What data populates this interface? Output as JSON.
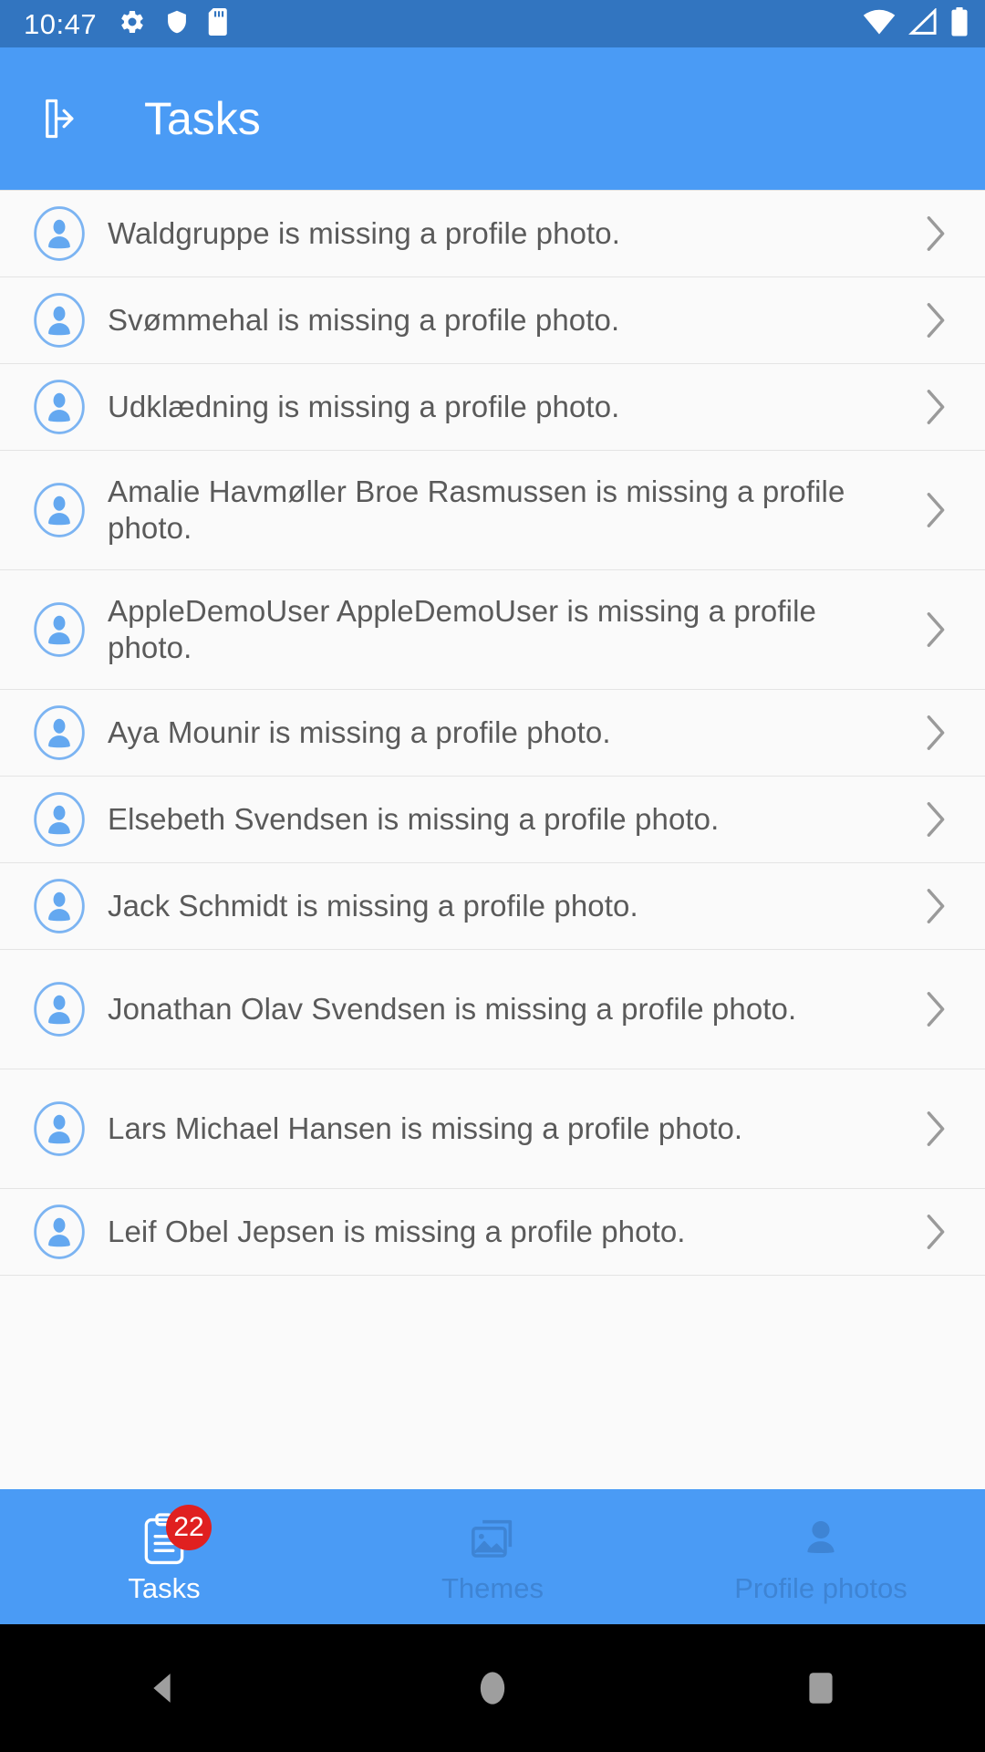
{
  "status_bar": {
    "time": "10:47",
    "left_icons": [
      "gear-icon",
      "shield-icon",
      "sd-card-icon"
    ],
    "right_icons": [
      "wifi-icon",
      "cell-signal-icon",
      "battery-icon"
    ],
    "background": "#3275c0"
  },
  "app_bar": {
    "title": "Tasks",
    "nav_icon": "logout-icon",
    "background": "#4a9bf5"
  },
  "list": {
    "items": [
      {
        "text": "Waldgruppe is missing a profile photo.",
        "avatar": "account-circle-icon",
        "chevron": "chevron-right-icon"
      },
      {
        "text": "Svømmehal is missing a profile photo.",
        "avatar": "account-circle-icon",
        "chevron": "chevron-right-icon"
      },
      {
        "text": "Udklædning is missing a profile photo.",
        "avatar": "account-circle-icon",
        "chevron": "chevron-right-icon"
      },
      {
        "text": "Amalie Havmøller Broe Rasmussen is missing a profile photo.",
        "avatar": "account-circle-icon",
        "chevron": "chevron-right-icon"
      },
      {
        "text": "AppleDemoUser AppleDemoUser is missing a profile photo.",
        "avatar": "account-circle-icon",
        "chevron": "chevron-right-icon"
      },
      {
        "text": "Aya Mounir is missing a profile photo.",
        "avatar": "account-circle-icon",
        "chevron": "chevron-right-icon"
      },
      {
        "text": "Elsebeth Svendsen is missing a profile photo.",
        "avatar": "account-circle-icon",
        "chevron": "chevron-right-icon"
      },
      {
        "text": "Jack Schmidt is missing a profile photo.",
        "avatar": "account-circle-icon",
        "chevron": "chevron-right-icon"
      },
      {
        "text": "Jonathan Olav Svendsen is missing a profile photo.",
        "avatar": "account-circle-icon",
        "chevron": "chevron-right-icon"
      },
      {
        "text": "Lars Michael Hansen is missing a profile photo.",
        "avatar": "account-circle-icon",
        "chevron": "chevron-right-icon"
      },
      {
        "text": "Leif Obel Jepsen is missing a profile photo.",
        "avatar": "account-circle-icon",
        "chevron": "chevron-right-icon"
      }
    ],
    "background": "#fafafa",
    "text_color": "#5a5a5a"
  },
  "tab_bar": {
    "background": "#4a9bf5",
    "active_color": "#ffffff",
    "inactive_color": "#3e84d4",
    "tabs": [
      {
        "label": "Tasks",
        "icon": "clipboard-icon",
        "active": true,
        "badge": "22"
      },
      {
        "label": "Themes",
        "icon": "collections-images-icon",
        "active": false,
        "badge": ""
      },
      {
        "label": "Profile photos",
        "icon": "person-icon",
        "active": false,
        "badge": ""
      }
    ],
    "badge_color": "#e02020"
  },
  "nav_bar": {
    "buttons": [
      "back-triangle-icon",
      "home-circle-icon",
      "recents-square-icon"
    ],
    "background": "#000000"
  }
}
